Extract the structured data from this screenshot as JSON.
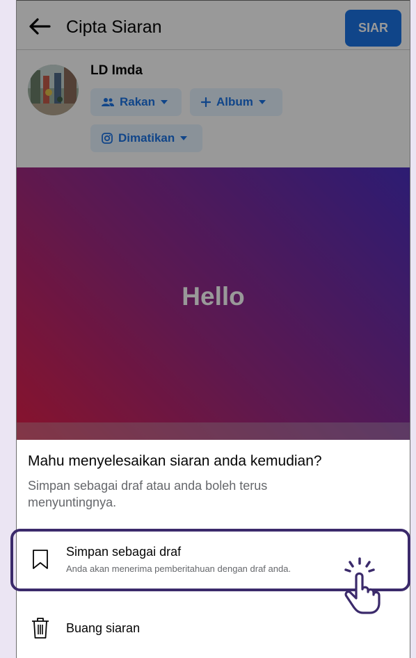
{
  "header": {
    "title": "Cipta Siaran",
    "post_label": "SIAR"
  },
  "profile": {
    "name": "LD Imda",
    "audience_label": "Rakan",
    "album_label": "Album",
    "instagram_label": "Dimatikan"
  },
  "post": {
    "text": "Hello"
  },
  "sheet": {
    "title": "Mahu menyelesaikan siaran anda kemudian?",
    "description": "Simpan sebagai draf atau anda boleh terus menyuntingnya.",
    "options": [
      {
        "title": "Simpan sebagai draf",
        "subtitle": "Anda akan menerima pemberitahuan dengan draf anda.",
        "icon": "bookmark-icon"
      },
      {
        "title": "Buang siaran",
        "icon": "trash-icon"
      }
    ]
  },
  "colors": {
    "accent": "#1b74e4",
    "highlight": "#3b2a6b",
    "background": "#ebe5f3"
  }
}
